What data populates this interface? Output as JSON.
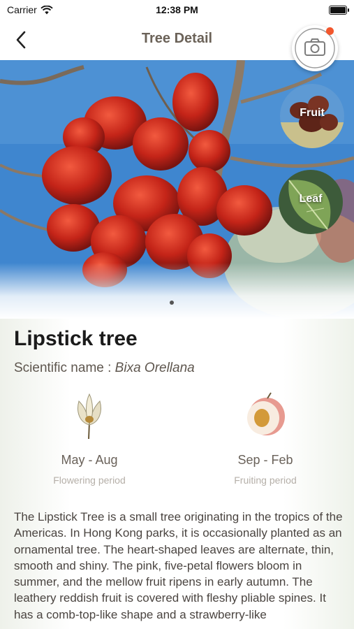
{
  "status_bar": {
    "carrier": "Carrier",
    "time": "12:38 PM"
  },
  "nav": {
    "title": "Tree Detail"
  },
  "hero": {
    "thumbnails": [
      {
        "label": "Fruit"
      },
      {
        "label": "Leaf"
      }
    ],
    "notification_color": "#f2572d"
  },
  "tree": {
    "common_name": "Lipstick tree",
    "scientific_label": "Scientific name : ",
    "scientific_name": "Bixa Orellana",
    "flowering": {
      "months": "May - Aug",
      "label": "Flowering period"
    },
    "fruiting": {
      "months": "Sep - Feb",
      "label": "Fruiting period"
    },
    "description": "The Lipstick Tree is a small tree originating in the tropics of the Americas. In Hong Kong parks, it is occasionally planted as an ornamental tree. The heart-shaped leaves are alternate, thin, smooth and shiny. The pink, five-petal flowers bloom in summer, and the mellow fruit ripens in early autumn. The leathery reddish fruit is covered with fleshy pliable spines. It has a comb-top-like shape and a strawberry-like"
  },
  "colors": {
    "title_text": "#6b6258",
    "accent_red": "#d2301f",
    "sky": "#3f86cf"
  }
}
